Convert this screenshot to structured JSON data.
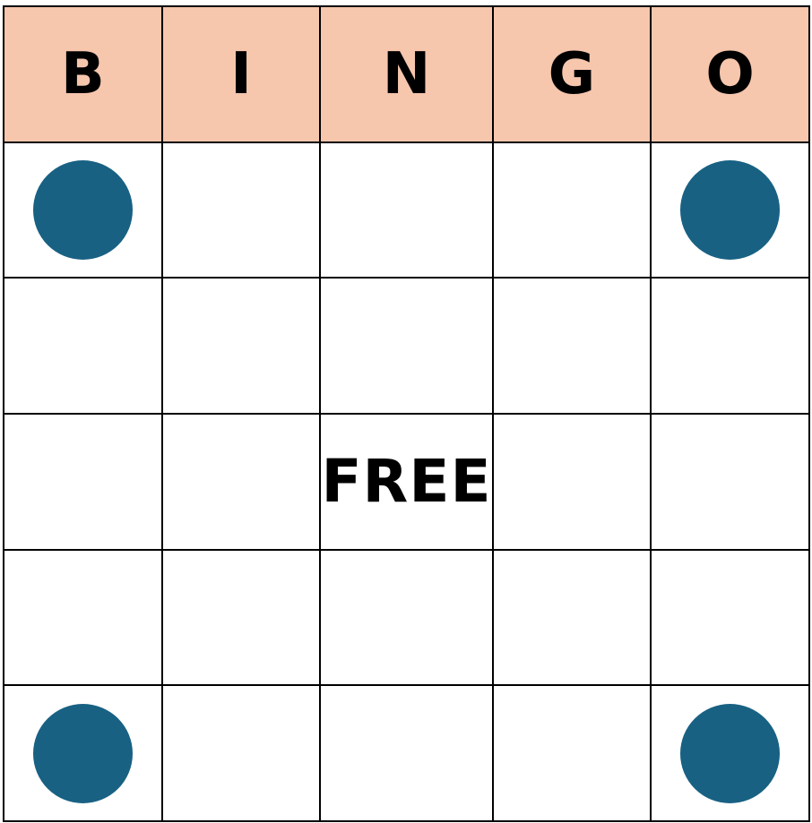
{
  "card": {
    "header_letters": [
      "B",
      "I",
      "N",
      "G",
      "O"
    ],
    "header_color": "#f6c6ad",
    "marker_color": "#186183",
    "free_label": "FREE",
    "free_position": {
      "row": 3,
      "col": 3
    },
    "marked_cells": [
      {
        "row": 1,
        "col": 1
      },
      {
        "row": 1,
        "col": 5
      },
      {
        "row": 5,
        "col": 1
      },
      {
        "row": 5,
        "col": 5
      }
    ]
  }
}
